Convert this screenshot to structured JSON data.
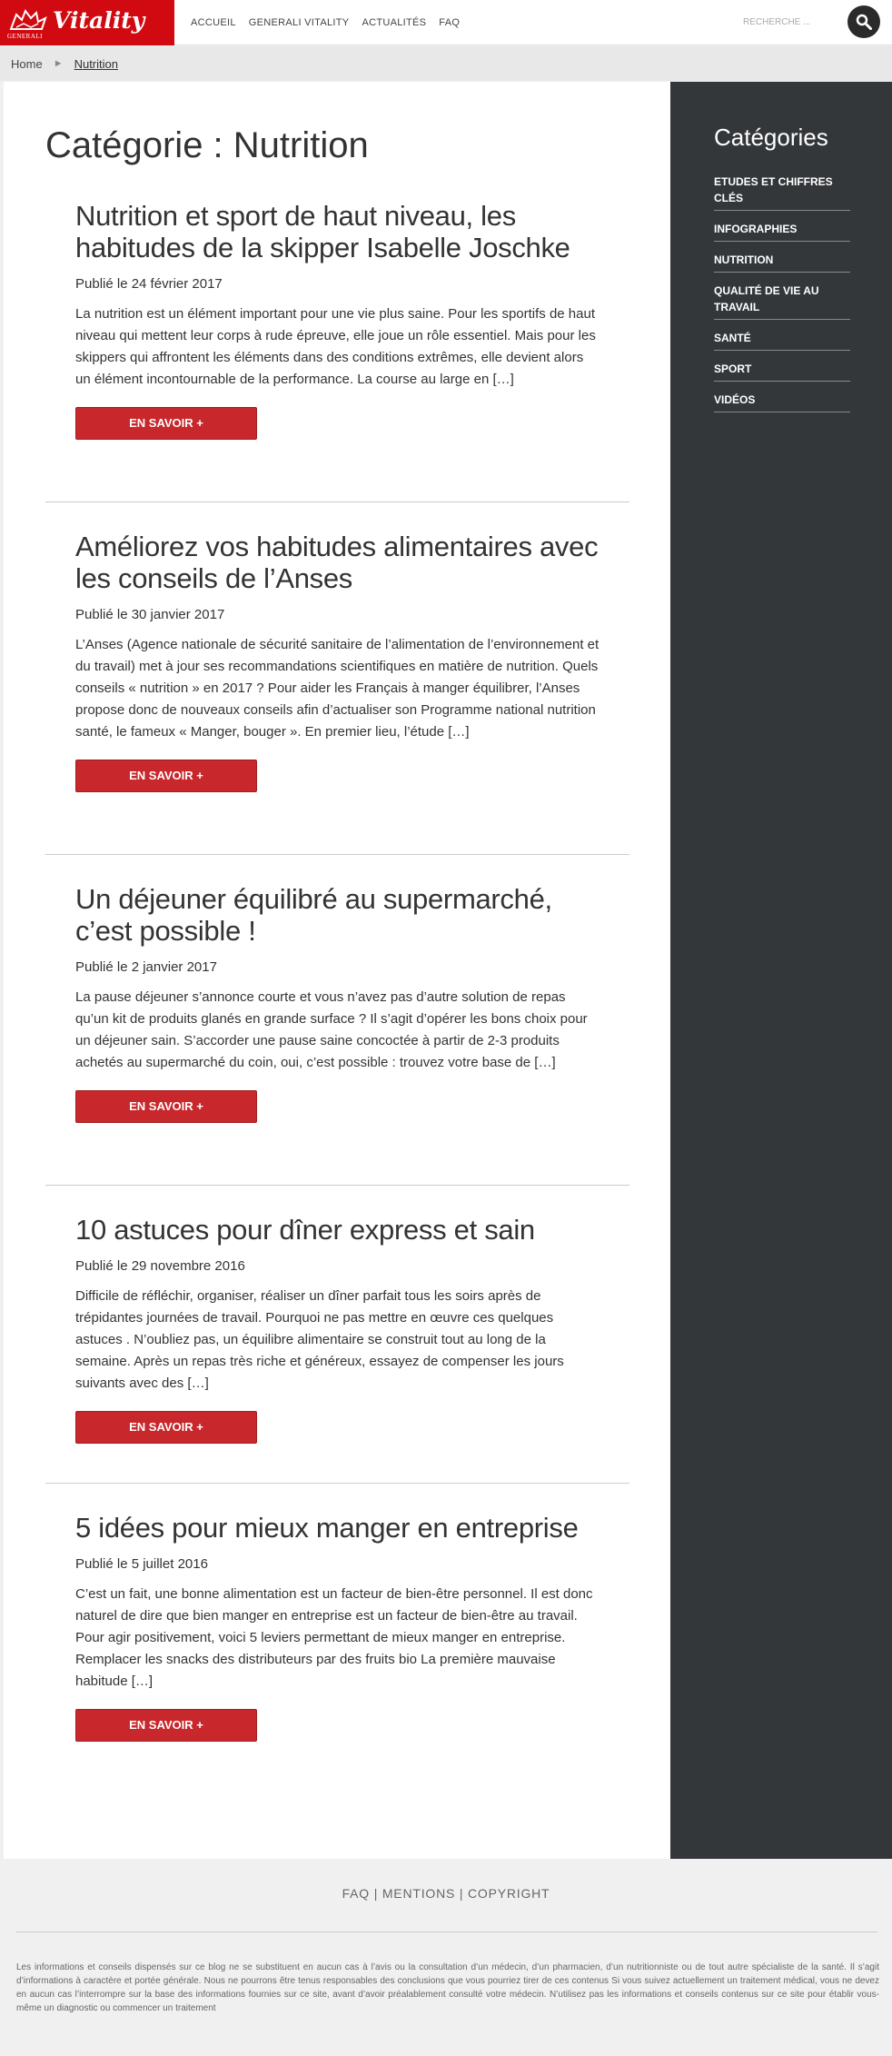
{
  "header": {
    "logo_brand": "Vitality",
    "logo_company": "GENERALI",
    "nav": [
      "ACCUEIL",
      "GENERALI VITALITY",
      "ACTUALITÉS",
      "FAQ"
    ],
    "search_placeholder": "RECHERCHE ..."
  },
  "breadcrumb": {
    "home": "Home",
    "separator": "►",
    "current": "Nutrition"
  },
  "main": {
    "title": "Catégorie : Nutrition",
    "articles": [
      {
        "title": "Nutrition et sport de haut niveau, les habitudes de la skipper Isabelle Joschke",
        "date": "Publié le 24 février 2017",
        "excerpt": "La nutrition est un élément important pour une vie plus saine. Pour les sportifs de haut niveau qui mettent leur corps à rude épreuve, elle joue un rôle essentiel. Mais pour les skippers qui affrontent les éléments dans des conditions extrêmes, elle devient alors un élément incontournable de la performance. La course au large en […]",
        "button": "EN SAVOIR +"
      },
      {
        "title": "Améliorez vos habitudes alimentaires avec les conseils de l’Anses",
        "date": "Publié le 30 janvier 2017",
        "excerpt": "L’Anses (Agence nationale de sécurité sanitaire de l’alimentation de l’environnement et du travail) met à jour ses recommandations scientifiques en matière de nutrition. Quels conseils « nutrition » en 2017 ? Pour aider les Français à manger équilibrer, l’Anses propose donc de nouveaux conseils afin d’actualiser son Programme national nutrition santé, le fameux « Manger, bouger ». En premier lieu, l’étude […]",
        "button": "EN SAVOIR +"
      },
      {
        "title": "Un déjeuner équilibré au supermarché, c’est possible !",
        "date": "Publié le 2 janvier 2017",
        "excerpt": "La pause déjeuner s’annonce courte et vous n’avez pas d’autre solution de repas qu’un kit de produits glanés en grande surface ? Il s’agit d’opérer les bons choix pour un déjeuner sain. S’accorder une pause saine concoctée à partir de 2-3 produits achetés au supermarché du coin, oui, c’est possible : trouvez votre base de […]",
        "button": "EN SAVOIR +"
      },
      {
        "title": "10 astuces pour dîner express et sain",
        "date": "Publié le 29 novembre 2016",
        "excerpt": "Difficile de réfléchir, organiser, réaliser un dîner parfait tous les soirs après de trépidantes journées de travail. Pourquoi ne pas mettre en œuvre ces quelques astuces . N’oubliez pas, un équilibre alimentaire se construit tout au long de la semaine. Après un repas très riche et généreux, essayez de compenser les jours suivants avec des […]",
        "button": "EN SAVOIR +"
      },
      {
        "title": "5 idées pour mieux manger en entreprise",
        "date": "Publié le 5 juillet 2016",
        "excerpt": "C’est un fait, une bonne alimentation est un facteur de bien-être personnel. Il est donc naturel de dire que bien manger en entreprise est un facteur de bien-être au travail. Pour agir positivement, voici 5 leviers permettant de mieux manger en entreprise. Remplacer les snacks des distributeurs par des fruits bio La première mauvaise habitude […]",
        "button": "EN SAVOIR +"
      }
    ]
  },
  "sidebar": {
    "title": "Catégories",
    "categories": [
      "ETUDES ET CHIFFRES CLÉS",
      "INFOGRAPHIES",
      "NUTRITION",
      "QUALITÉ DE VIE AU TRAVAIL",
      "SANTÉ",
      "SPORT",
      "VIDÉOS"
    ]
  },
  "footer": {
    "links": [
      "FAQ",
      "MENTIONS",
      "COPYRIGHT"
    ],
    "link_separator": "|",
    "disclaimer": "Les informations et conseils dispensés sur ce blog ne se substituent en aucun cas à l’avis ou la consultation d’un médecin, d’un pharmacien, d’un nutritionniste ou de tout autre spécialiste de la santé. Il s’agit d’informations à caractère et portée générale. Nous ne pourrons être tenus responsables des conclusions que vous pourriez tirer de ces contenus Si vous suivez actuellement un traitement médical, vous ne devez en aucun cas l’interrompre sur la base des informations fournies sur ce site, avant d’avoir préalablement consulté votre médecin. N’utilisez pas les informations et conseils contenus sur ce site pour établir vous-même un diagnostic ou commencer un traitement"
  },
  "colors": {
    "brand_red": "#d10a11",
    "button_red": "#c8272b",
    "sidebar_bg": "#34373a",
    "search_button": "#2a2a2a"
  }
}
